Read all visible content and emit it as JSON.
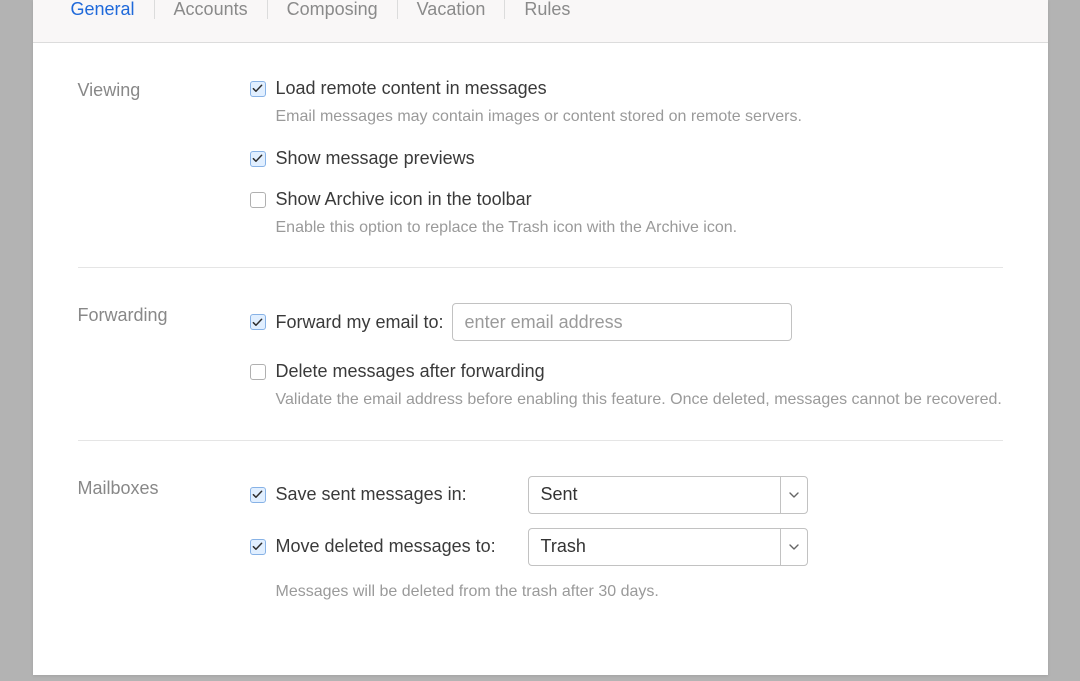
{
  "tabs": {
    "general": "General",
    "accounts": "Accounts",
    "composing": "Composing",
    "vacation": "Vacation",
    "rules": "Rules"
  },
  "sections": {
    "viewing": {
      "label": "Viewing",
      "loadRemote": {
        "label": "Load remote content in messages",
        "description": "Email messages may contain images or content stored on remote servers."
      },
      "showPreviews": {
        "label": "Show message previews"
      },
      "showArchive": {
        "label": "Show Archive icon in the toolbar",
        "description": "Enable this option to replace the Trash icon with the Archive icon."
      }
    },
    "forwarding": {
      "label": "Forwarding",
      "forwardTo": {
        "label": "Forward my email to:",
        "placeholder": "enter email address"
      },
      "deleteAfter": {
        "label": "Delete messages after forwarding",
        "description": "Validate the email address before enabling this feature. Once deleted, messages cannot be recovered."
      }
    },
    "mailboxes": {
      "label": "Mailboxes",
      "saveSent": {
        "label": "Save sent messages in:",
        "value": "Sent"
      },
      "moveDeleted": {
        "label": "Move deleted messages to:",
        "value": "Trash"
      },
      "description": "Messages will be deleted from the trash after 30 days."
    }
  }
}
